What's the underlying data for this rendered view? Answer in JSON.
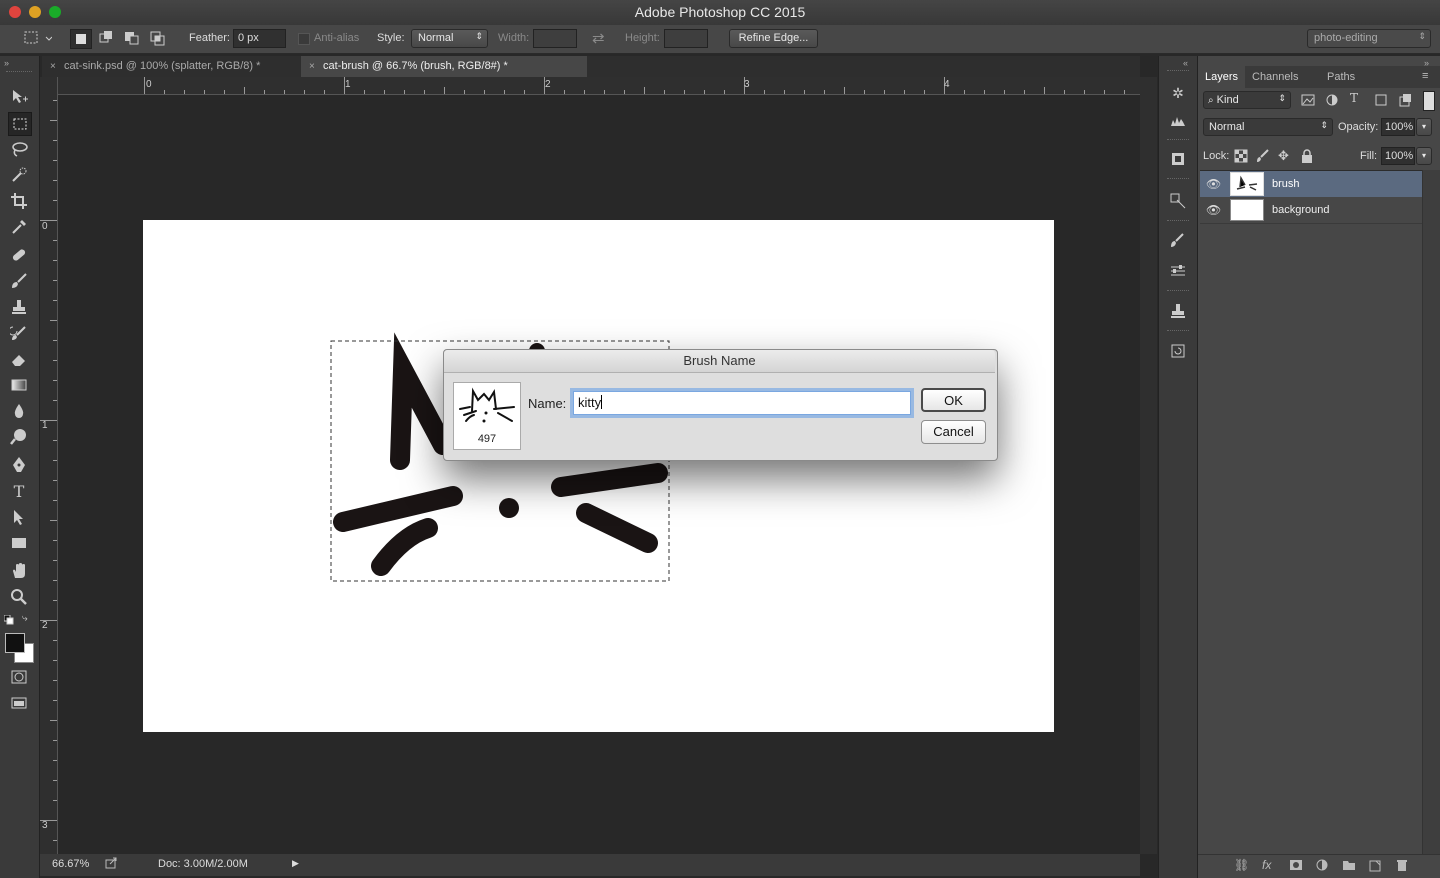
{
  "app": {
    "title": "Adobe Photoshop CC 2015"
  },
  "options_bar": {
    "feather_label": "Feather:",
    "feather_value": "0 px",
    "antialias_label": "Anti-alias",
    "style_label": "Style:",
    "style_value": "Normal",
    "width_label": "Width:",
    "height_label": "Height:",
    "refine_edge_label": "Refine Edge...",
    "workspace_value": "photo-editing"
  },
  "tabs": [
    {
      "label": "cat-sink.psd @ 100% (splatter, RGB/8) *",
      "active": false
    },
    {
      "label": "cat-brush @ 66.7% (brush, RGB/8#) *",
      "active": true
    }
  ],
  "rulers": {
    "horizontal": [
      "0",
      "1",
      "2",
      "3",
      "4"
    ],
    "vertical": [
      "0",
      "1",
      "2",
      "3"
    ]
  },
  "status": {
    "zoom": "66.67%",
    "doc": "Doc: 3.00M/2.00M"
  },
  "panel": {
    "tabs": [
      "Layers",
      "Channels",
      "Paths"
    ],
    "kind_filter": "Kind",
    "blend_mode": "Normal",
    "opacity_label": "Opacity:",
    "opacity_value": "100%",
    "lock_label": "Lock:",
    "fill_label": "Fill:",
    "fill_value": "100%",
    "layers": [
      {
        "name": "brush",
        "selected": true
      },
      {
        "name": "background",
        "selected": false
      }
    ]
  },
  "dialog": {
    "title": "Brush Name",
    "name_label": "Name:",
    "name_value": "kitty",
    "brush_size": "497",
    "ok_label": "OK",
    "cancel_label": "Cancel"
  },
  "colors": {
    "selected_layer": "#5b6a80",
    "dialog_focus": "#5e9ae6"
  }
}
